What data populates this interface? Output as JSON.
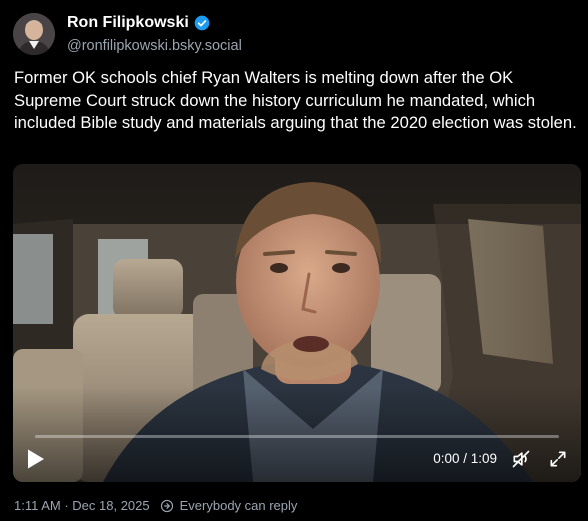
{
  "post": {
    "author": {
      "display_name": "Ron Filipkowski",
      "handle": "@ronfilipkowski.bsky.social",
      "verified": true,
      "verified_color": "#1d9bf0"
    },
    "text": "Former OK schools chief Ryan Walters is melting down after the OK Supreme Court struck down the history curriculum he mandated, which included Bible study and materials arguing that the 2020 election was stolen.",
    "video": {
      "time_display": "0:00 / 1:09",
      "progress_fraction": 0,
      "muted": true,
      "controls": [
        "play-icon",
        "muted-speaker-icon",
        "fullscreen-icon"
      ]
    },
    "timestamp": "1:11 AM · Dec 18, 2025",
    "reply_setting": "Everybody can reply"
  },
  "colors": {
    "background": "#000000",
    "text": "#ffffff",
    "muted_text": "#9aa5b1"
  }
}
